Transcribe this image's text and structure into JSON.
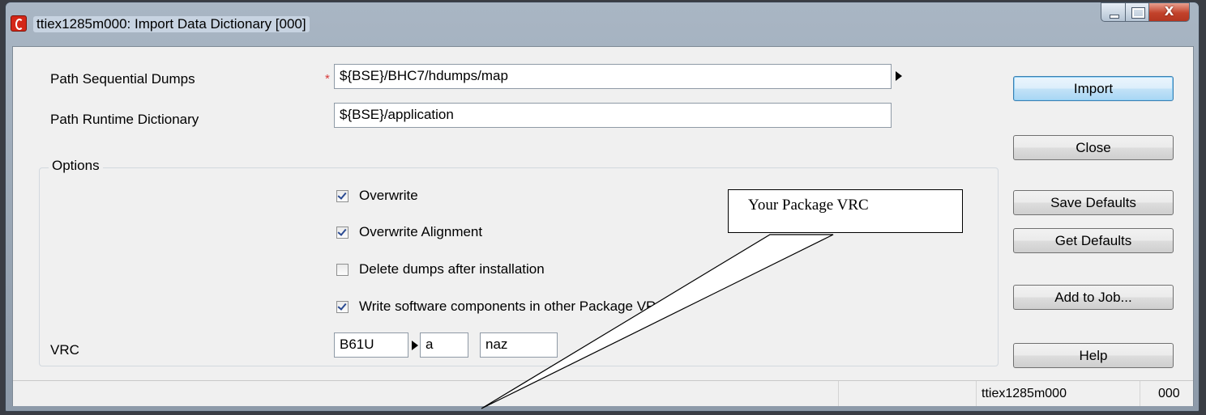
{
  "window": {
    "title": "ttiex1285m000: Import Data Dictionary [000]",
    "close_glyph": "X"
  },
  "form": {
    "path_sequential_dumps": {
      "label": "Path Sequential Dumps",
      "required_marker": "*",
      "value": "${BSE}/BHC7/hdumps/map"
    },
    "path_runtime_dictionary": {
      "label": "Path Runtime Dictionary",
      "value": "${BSE}/application"
    },
    "options": {
      "title": "Options",
      "checkboxes": [
        {
          "label": "Overwrite",
          "checked": true
        },
        {
          "label": "Overwrite Alignment",
          "checked": true
        },
        {
          "label": "Delete dumps after installation",
          "checked": false
        },
        {
          "label": "Write software components in other Package VRC",
          "checked": true
        }
      ]
    },
    "vrc": {
      "label": "VRC",
      "version": "B61U",
      "release": "a",
      "customer": "naz"
    }
  },
  "buttons": {
    "import": "Import",
    "close": "Close",
    "save_defaults": "Save Defaults",
    "get_defaults": "Get Defaults",
    "add_to_job": "Add to Job...",
    "help": "Help"
  },
  "statusbar": {
    "session": "ttiex1285m000",
    "company": "000"
  },
  "callout": {
    "text": "Your Package VRC"
  },
  "colors": {
    "primary_button": "#a8d6f4",
    "required_marker": "#d93a3a",
    "title_icon": "#d42718"
  }
}
